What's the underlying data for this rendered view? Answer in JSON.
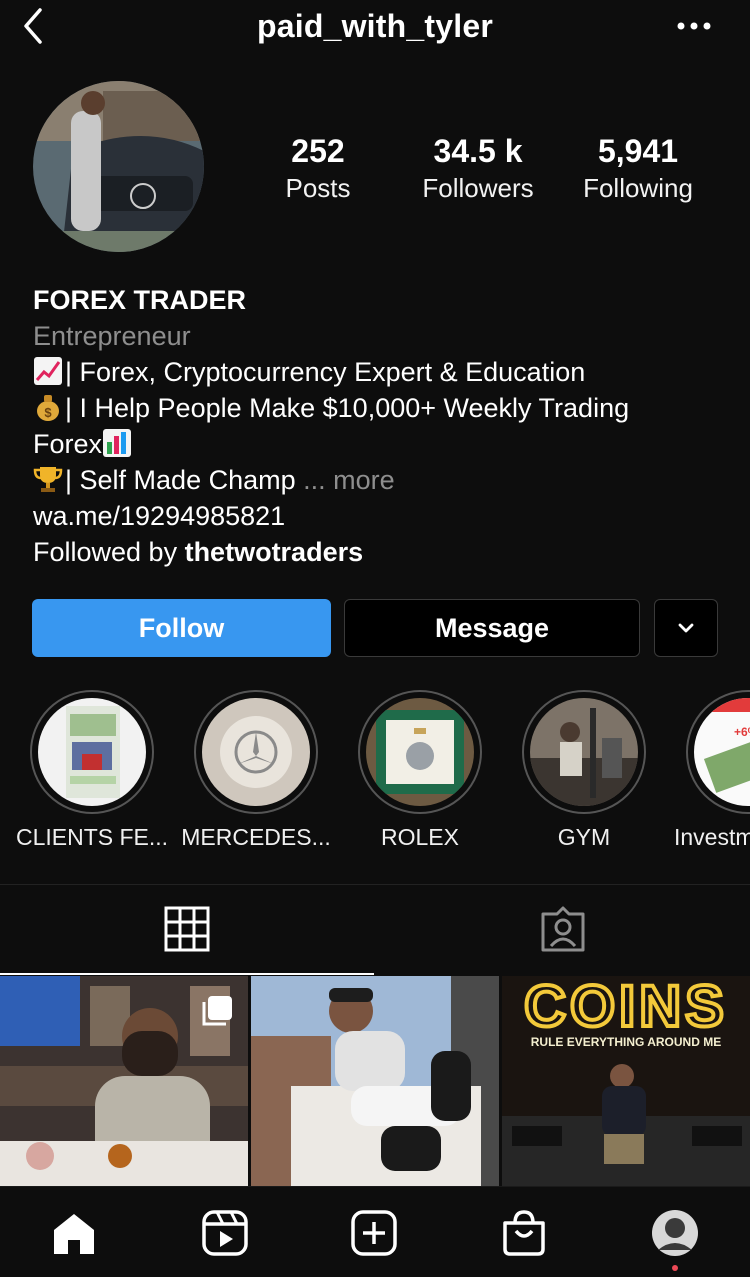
{
  "header": {
    "username": "paid_with_tyler"
  },
  "stats": {
    "posts": {
      "value": "252",
      "label": "Posts"
    },
    "followers": {
      "value": "34.5 k",
      "label": "Followers"
    },
    "following": {
      "value": "5,941",
      "label": "Following"
    }
  },
  "bio": {
    "name": "FOREX TRADER",
    "category": "Entrepreneur",
    "line1": "| Forex, Cryptocurrency Expert & Education",
    "line2a": "| I Help People Make $10,000+ Weekly Trading",
    "line2b": "Forex",
    "line3": "| Self Made Champ",
    "more": "... more",
    "link": "wa.me/19294985821",
    "followed_by_prefix": "Followed by ",
    "followed_by_user": "thetwotraders"
  },
  "actions": {
    "follow": "Follow",
    "message": "Message"
  },
  "highlights": [
    {
      "label": "CLIENTS FE..."
    },
    {
      "label": "MERCEDES..."
    },
    {
      "label": "ROLEX"
    },
    {
      "label": "GYM"
    },
    {
      "label": "Investm",
      "badge": "+6%"
    }
  ],
  "posts": [
    {
      "alt": ""
    },
    {
      "alt": ""
    },
    {
      "title": "COINS",
      "subtitle": "RULE EVERYTHING AROUND ME"
    }
  ],
  "colors": {
    "follow_blue": "#3897f0",
    "background": "#0d0d0d",
    "notification_red": "#ed4956",
    "secondary_text": "#8e8e8e"
  }
}
